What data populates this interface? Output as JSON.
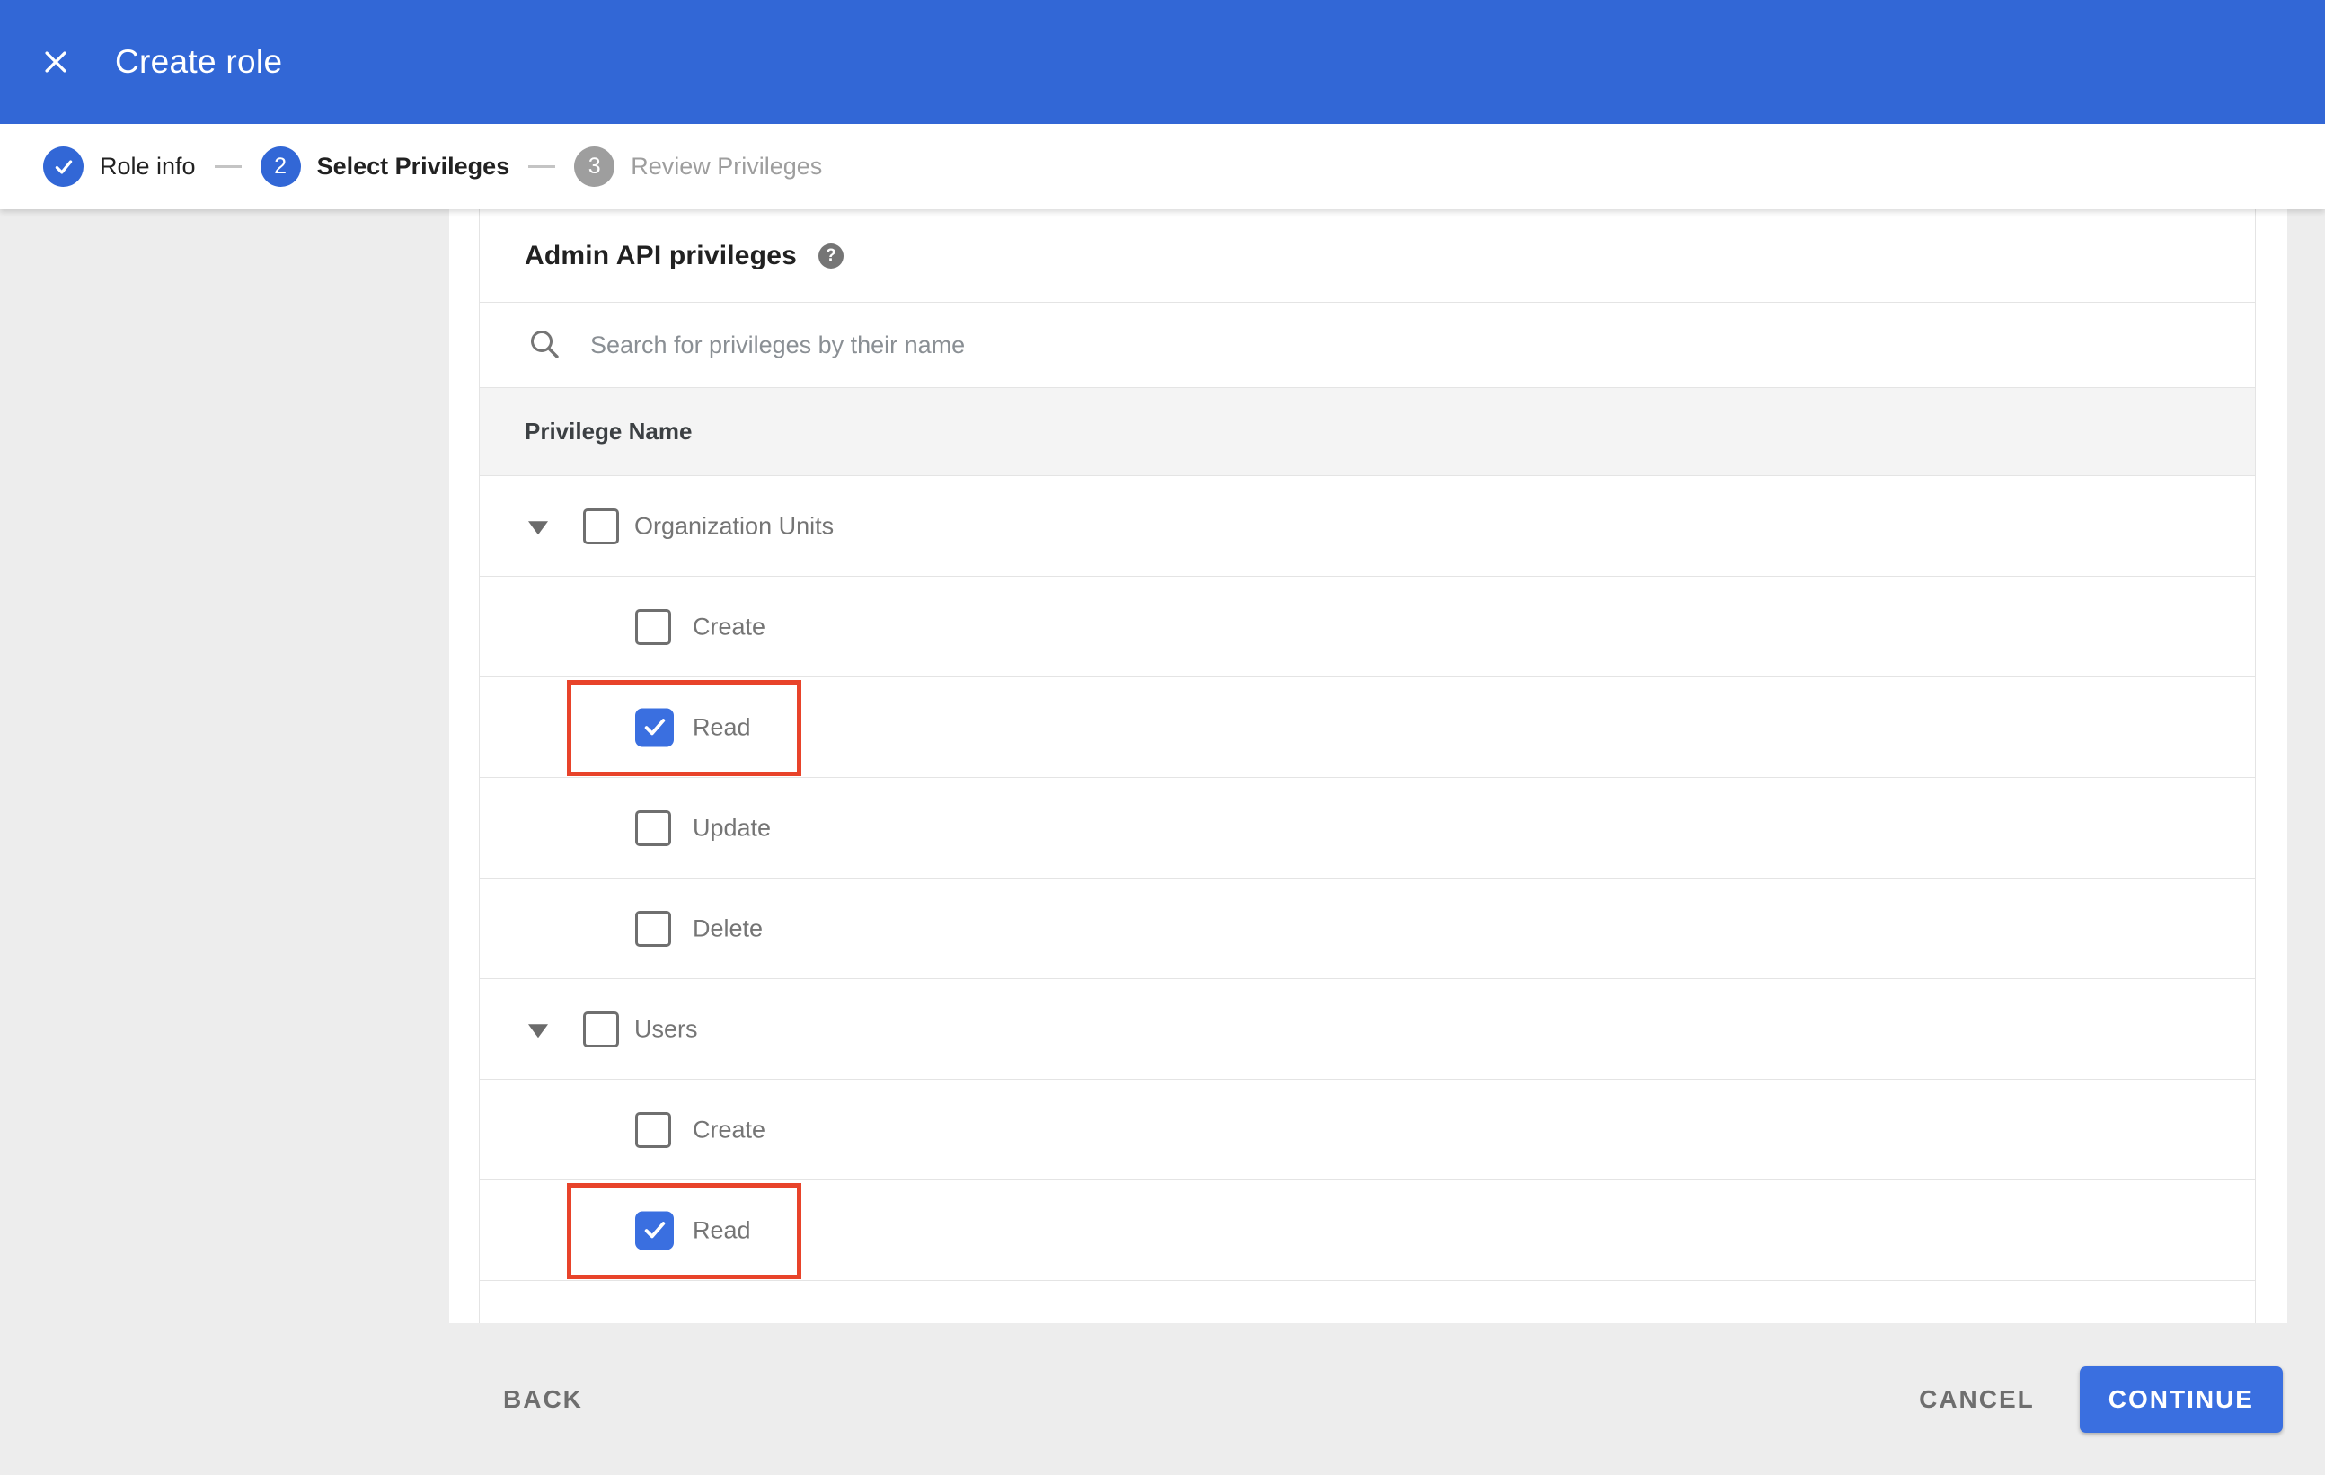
{
  "header": {
    "title": "Create role"
  },
  "stepper": {
    "steps": [
      {
        "label": "Role info",
        "state": "completed"
      },
      {
        "label": "Select Privileges",
        "number": "2",
        "state": "active"
      },
      {
        "label": "Review Privileges",
        "number": "3",
        "state": "upcoming"
      }
    ]
  },
  "panel": {
    "title": "Admin API privileges",
    "help_glyph": "?",
    "search_placeholder": "Search for privileges by their name",
    "table_header": "Privilege Name"
  },
  "privileges": {
    "rows": [
      {
        "label": "Organization Units",
        "type": "parent",
        "checked": false,
        "expanded": true
      },
      {
        "label": "Create",
        "type": "child",
        "checked": false
      },
      {
        "label": "Read",
        "type": "child",
        "checked": true,
        "highlighted": true
      },
      {
        "label": "Update",
        "type": "child",
        "checked": false
      },
      {
        "label": "Delete",
        "type": "child",
        "checked": false
      },
      {
        "label": "Users",
        "type": "parent",
        "checked": false,
        "expanded": true
      },
      {
        "label": "Create",
        "type": "child",
        "checked": false
      },
      {
        "label": "Read",
        "type": "child",
        "checked": true,
        "highlighted": true
      }
    ]
  },
  "footer": {
    "back_label": "BACK",
    "cancel_label": "CANCEL",
    "continue_label": "CONTINUE"
  },
  "annotations": {
    "highlighted_privileges": [
      "Organization Units > Read",
      "Users > Read"
    ]
  },
  "colors": {
    "app_bar_blue": "#3267d6",
    "accent_blue": "#3a6fe0",
    "highlight_red": "#e8432a",
    "page_bg": "#ededed",
    "header_row_bg": "#f4f4f4",
    "row_border": "#e4e4e4",
    "text_dark": "#212121",
    "text_gray": "#757575",
    "text_light_gray": "#9e9e9e",
    "dash_gray": "#c4c4c4"
  }
}
